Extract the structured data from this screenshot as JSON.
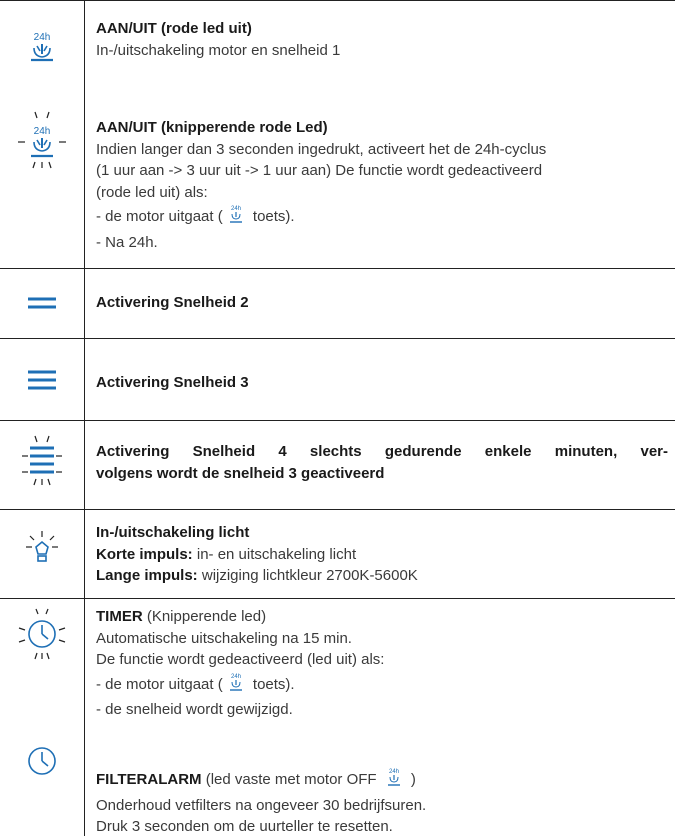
{
  "rows": [
    {
      "icon": "fan-24h-icon",
      "title": "AAN/UIT (rode led uit)",
      "lines": [
        "In-/uitschakeling motor en snelheid 1"
      ]
    },
    {
      "icon": "fan-24h-blinking-icon",
      "title": "AAN/UIT (knipperende rode Led)",
      "lines": [
        "Indien langer dan 3 seconden ingedrukt, activeert het de 24h-cyclus",
        "(1 uur aan -> 3 uur uit -> 1 uur aan) De functie wordt gedeactiveerd",
        "(rode led uit) als:",
        "- de motor uitgaat (",
        "toets).",
        "- Na 24h."
      ]
    },
    {
      "icon": "speed-2-icon",
      "title": "Activering Snelheid 2"
    },
    {
      "icon": "speed-3-icon",
      "title": "Activering Snelheid 3"
    },
    {
      "icon": "speed-4-icon",
      "title_line1": "Activering Snelheid 4 slechts gedurende enkele minuten, ver-",
      "title_line2": "volgens wordt de snelheid 3 geactiveerd"
    },
    {
      "icon": "light-icon",
      "title": "In-/uitschakeling licht",
      "short_label": "Korte impuls:",
      "short_text": " in- en uitschakeling licht",
      "long_label": "Lange impuls:",
      "long_text": " wijziging lichtkleur 2700K-5600K"
    },
    {
      "icon": "timer-blinking-icon",
      "title": "TIMER",
      "title_suffix": " (Knipperende led)",
      "lines": [
        "Automatische uitschakeling na 15 min.",
        "De functie wordt gedeactiveerd (led uit) als:",
        "- de motor uitgaat (",
        "toets).",
        "- de snelheid wordt gewijzigd."
      ]
    },
    {
      "icon": "filter-alarm-icon",
      "title": "FILTERALARM",
      "title_suffix": " (led vaste met motor OFF",
      "title_end": " )",
      "lines": [
        "Onderhoud vetfilters na ongeveer 30 bedrijfsuren.",
        "Druk 3 seconden om de uurteller te resetten."
      ]
    }
  ],
  "icon_text": "24h",
  "colors": {
    "accent": "#1e6fb5",
    "text": "#3a3a3a",
    "border": "#222222"
  }
}
